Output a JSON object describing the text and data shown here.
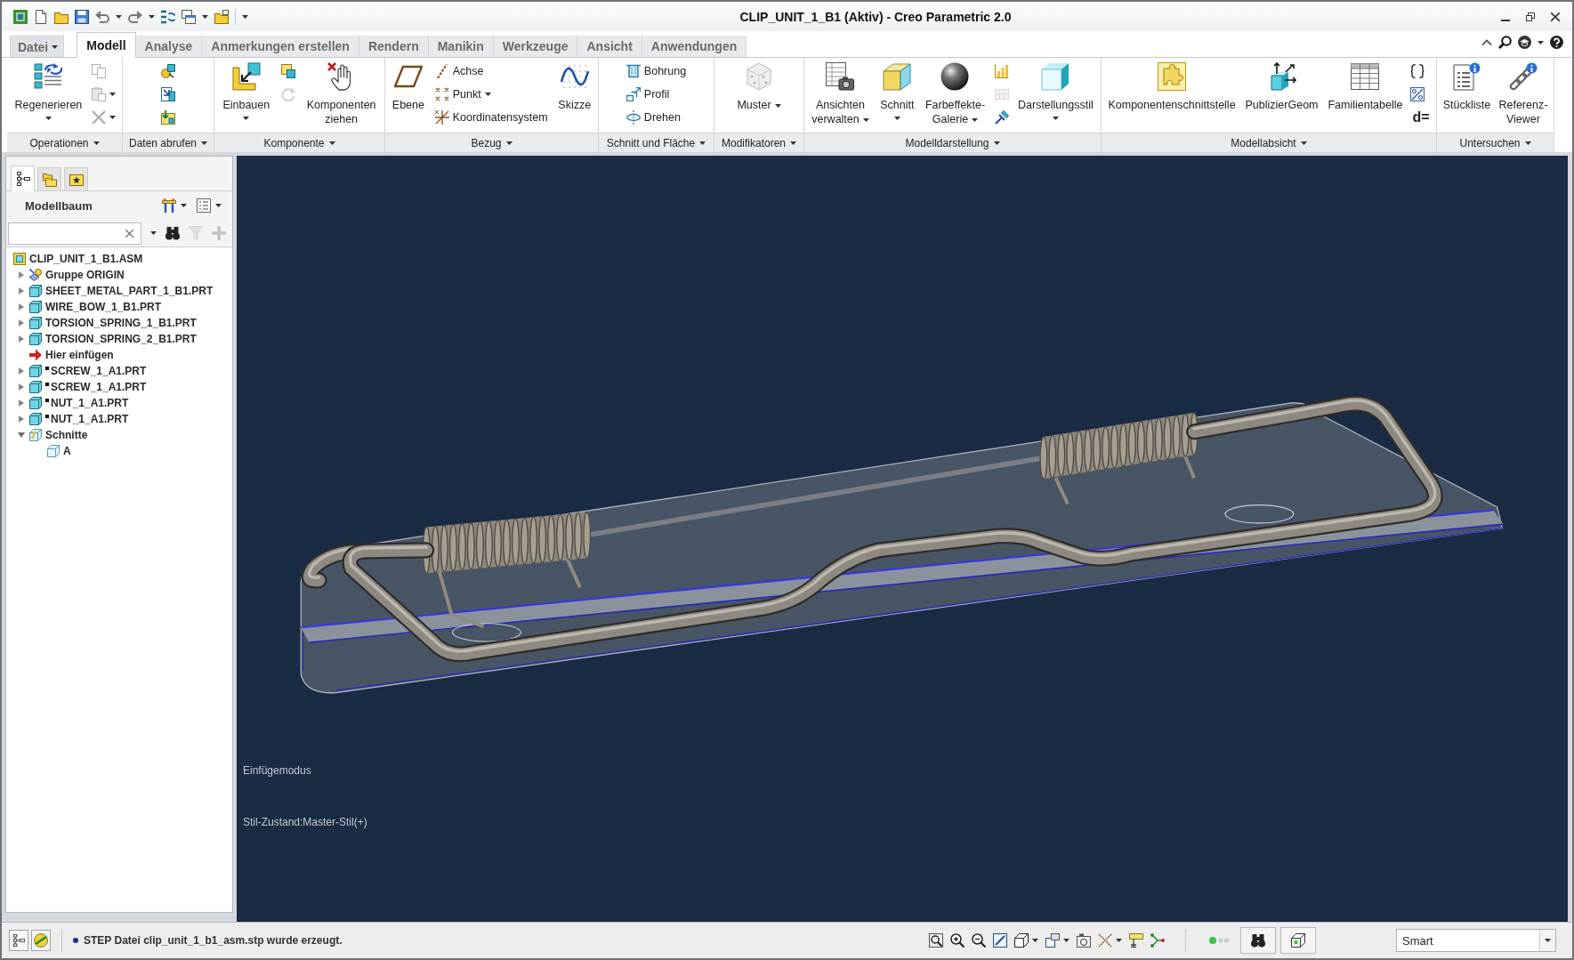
{
  "window": {
    "title": "CLIP_UNIT_1_B1 (Aktiv) - Creo Parametric 2.0"
  },
  "tabs": [
    {
      "label": "Datei",
      "kind": "menu",
      "selected": false
    },
    {
      "label": "Modell",
      "kind": "tab",
      "selected": true
    },
    {
      "label": "Analyse",
      "kind": "tab",
      "selected": false
    },
    {
      "label": "Anmerkungen erstellen",
      "kind": "tab",
      "selected": false
    },
    {
      "label": "Rendern",
      "kind": "tab",
      "selected": false
    },
    {
      "label": "Manikin",
      "kind": "tab",
      "selected": false
    },
    {
      "label": "Werkzeuge",
      "kind": "tab",
      "selected": false
    },
    {
      "label": "Ansicht",
      "kind": "tab",
      "selected": false
    },
    {
      "label": "Anwendungen",
      "kind": "tab",
      "selected": false
    }
  ],
  "ribbon_groups": [
    {
      "label": "Operationen",
      "commands": [
        {
          "kind": "split",
          "label": "Regenerieren",
          "disabled": false
        },
        {
          "kind": "icon",
          "disabled": true
        },
        {
          "kind": "icon",
          "disabled": true,
          "menu": true
        },
        {
          "kind": "icon",
          "disabled": true,
          "menu": true
        }
      ]
    },
    {
      "label": "Daten abrufen",
      "commands": [
        {
          "kind": "icon",
          "disabled": false
        },
        {
          "kind": "icon",
          "disabled": false
        },
        {
          "kind": "icon",
          "disabled": false
        }
      ]
    },
    {
      "label": "Komponente",
      "commands": [
        {
          "kind": "split",
          "label": "Einbauen",
          "disabled": false
        },
        {
          "kind": "icon",
          "disabled": false
        },
        {
          "kind": "icon",
          "disabled": true
        },
        {
          "kind": "large",
          "label": "Komponenten\nziehen",
          "disabled": false
        }
      ]
    },
    {
      "label": "Bezug",
      "commands": [
        {
          "kind": "large",
          "label": "Ebene",
          "disabled": false
        },
        {
          "kind": "small",
          "label": "Achse",
          "disabled": false
        },
        {
          "kind": "small",
          "label": "Punkt",
          "menu": true,
          "disabled": false
        },
        {
          "kind": "small",
          "label": "Koordinatensystem",
          "disabled": false
        },
        {
          "kind": "large",
          "label": "Skizze",
          "disabled": false
        }
      ]
    },
    {
      "label": "Schnitt und Fläche",
      "commands": [
        {
          "kind": "small",
          "label": "Bohrung",
          "disabled": false
        },
        {
          "kind": "small",
          "label": "Profil",
          "disabled": false
        },
        {
          "kind": "small",
          "label": "Drehen",
          "disabled": false
        }
      ]
    },
    {
      "label": "Modifikatoren",
      "commands": [
        {
          "kind": "large",
          "label": "Muster",
          "menu": true,
          "disabled": false
        }
      ]
    },
    {
      "label": "Modelldarstellung",
      "commands": [
        {
          "kind": "large",
          "label": "Ansichten\nverwalten",
          "menu": true,
          "disabled": false
        },
        {
          "kind": "split",
          "label": "Schnitt",
          "disabled": false
        },
        {
          "kind": "large",
          "label": "Farbeffekte-\nGalerie",
          "menu": true,
          "disabled": false
        },
        {
          "kind": "icon",
          "disabled": false
        },
        {
          "kind": "icon",
          "disabled": true
        },
        {
          "kind": "icon",
          "disabled": false
        },
        {
          "kind": "split",
          "label": "Darstellungsstil",
          "disabled": false
        }
      ]
    },
    {
      "label": "Modellabsicht",
      "commands": [
        {
          "kind": "large",
          "label": "Komponentenschnittstelle",
          "disabled": false
        },
        {
          "kind": "large",
          "label": "PublizierGeom",
          "disabled": false
        },
        {
          "kind": "large",
          "label": "Familientabelle",
          "disabled": false
        },
        {
          "kind": "icon",
          "disabled": false
        },
        {
          "kind": "icon",
          "disabled": false
        },
        {
          "kind": "glyph",
          "label": "d=",
          "disabled": false
        }
      ]
    },
    {
      "label": "Untersuchen",
      "commands": [
        {
          "kind": "large",
          "label": "Stückliste",
          "disabled": false
        },
        {
          "kind": "large",
          "label": "Referenz-\nViewer",
          "disabled": false
        }
      ]
    }
  ],
  "panel_tabs": [
    {
      "selected": true
    },
    {
      "selected": false
    },
    {
      "selected": false
    }
  ],
  "model_tree": {
    "title": "Modellbaum",
    "tools": [
      {
        "disabled": false
      },
      {
        "disabled": true
      },
      {
        "disabled": true
      }
    ],
    "items": [
      {
        "label": "CLIP_UNIT_1_B1.ASM",
        "kind": "assembly",
        "children": [
          {
            "label": "Gruppe ORIGIN",
            "kind": "group",
            "expanded": false
          },
          {
            "label": "SHEET_METAL_PART_1_B1.PRT",
            "kind": "part",
            "expanded": false,
            "marked": false
          },
          {
            "label": "WIRE_BOW_1_B1.PRT",
            "kind": "part",
            "expanded": false,
            "marked": false
          },
          {
            "label": "TORSION_SPRING_1_B1.PRT",
            "kind": "part",
            "expanded": false,
            "marked": false
          },
          {
            "label": "TORSION_SPRING_2_B1.PRT",
            "kind": "part",
            "expanded": false,
            "marked": false
          },
          {
            "label": "Hier einfügen",
            "kind": "insert"
          },
          {
            "label": "SCREW_1_A1.PRT",
            "kind": "part",
            "expanded": false,
            "marked": true
          },
          {
            "label": "SCREW_1_A1.PRT",
            "kind": "part",
            "expanded": false,
            "marked": true
          },
          {
            "label": "NUT_1_A1.PRT",
            "kind": "part",
            "expanded": false,
            "marked": true
          },
          {
            "label": "NUT_1_A1.PRT",
            "kind": "part",
            "expanded": false,
            "marked": true
          },
          {
            "label": "Schnitte",
            "kind": "folder",
            "expanded": true,
            "children": [
              {
                "label": "A",
                "kind": "section"
              }
            ]
          }
        ]
      }
    ]
  },
  "viewport": {
    "messages": [
      "Einfügemodus",
      "Stil-Zustand:Master-Stil(+)"
    ]
  },
  "status_bar": {
    "message": "STEP Datei clip_unit_1_b1_asm.stp wurde erzeugt.",
    "selection_filter": "Smart"
  }
}
